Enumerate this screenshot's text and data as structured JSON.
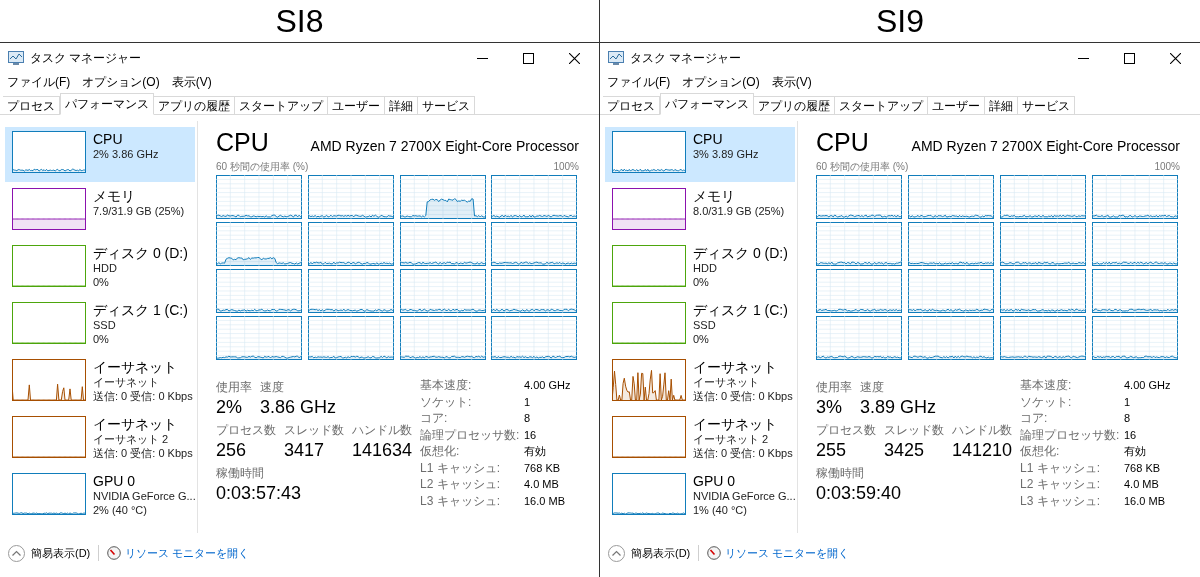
{
  "panels": [
    {
      "heading": "SI8",
      "window": {
        "title": "タスク マネージャー"
      },
      "menu": [
        "ファイル(F)",
        "オプション(O)",
        "表示(V)"
      ],
      "tabs": [
        {
          "label": "プロセス",
          "selected": false
        },
        {
          "label": "パフォーマンス",
          "selected": true
        },
        {
          "label": "アプリの履歴",
          "selected": false
        },
        {
          "label": "スタートアップ",
          "selected": false
        },
        {
          "label": "ユーザー",
          "selected": false
        },
        {
          "label": "詳細",
          "selected": false
        },
        {
          "label": "サービス",
          "selected": false
        }
      ],
      "sidebar": {
        "items": [
          {
            "kind": "cpu",
            "title": "CPU",
            "lines": [
              "2%  3.86 GHz"
            ],
            "selected": true
          },
          {
            "kind": "memory",
            "title": "メモリ",
            "lines": [
              "7.9/31.9 GB (25%)"
            ],
            "selected": false
          },
          {
            "kind": "disk",
            "title": "ディスク 0 (D:)",
            "lines": [
              "HDD",
              "0%"
            ],
            "selected": false
          },
          {
            "kind": "disk",
            "title": "ディスク 1 (C:)",
            "lines": [
              "SSD",
              "0%"
            ],
            "selected": false
          },
          {
            "kind": "ethernet",
            "title": "イーサネット",
            "lines": [
              "イーサネット",
              "送信: 0 受信: 0 Kbps"
            ],
            "selected": false
          },
          {
            "kind": "ethernet",
            "title": "イーサネット",
            "lines": [
              "イーサネット 2",
              "送信: 0 受信: 0 Kbps"
            ],
            "selected": false
          },
          {
            "kind": "gpu",
            "title": "GPU 0",
            "lines": [
              "NVIDIA GeForce G...",
              "2% (40 °C)"
            ],
            "selected": false
          }
        ]
      },
      "main": {
        "title": "CPU",
        "processor": "AMD Ryzen 7 2700X Eight-Core Processor",
        "graph_caption": "60 秒間の使用率 (%)",
        "graph_max": "100%",
        "stat_rows": [
          [
            {
              "label": "使用率",
              "value": "2%"
            },
            {
              "label": "速度",
              "value": "3.86 GHz"
            }
          ],
          [
            {
              "label": "プロセス数",
              "value": "256"
            },
            {
              "label": "スレッド数",
              "value": "3417"
            },
            {
              "label": "ハンドル数",
              "value": "141634"
            }
          ],
          [
            {
              "label": "稼働時間",
              "value": "0:03:57:43"
            }
          ]
        ],
        "details": [
          {
            "label": "基本速度:",
            "value": "4.00 GHz"
          },
          {
            "label": "ソケット:",
            "value": "1"
          },
          {
            "label": "コア:",
            "value": "8"
          },
          {
            "label": "論理プロセッサ数:",
            "value": "16"
          },
          {
            "label": "仮想化:",
            "value": "有効"
          },
          {
            "label": "L1 キャッシュ:",
            "value": "768 KB"
          },
          {
            "label": "L2 キャッシュ:",
            "value": "4.0 MB"
          },
          {
            "label": "L3 キャッシュ:",
            "value": "16.0 MB"
          }
        ]
      },
      "footer": {
        "collapse": "簡易表示(D)",
        "link": "リソース モニターを開く"
      }
    },
    {
      "heading": "SI9",
      "window": {
        "title": "タスク マネージャー"
      },
      "menu": [
        "ファイル(F)",
        "オプション(O)",
        "表示(V)"
      ],
      "tabs": [
        {
          "label": "プロセス",
          "selected": false
        },
        {
          "label": "パフォーマンス",
          "selected": true
        },
        {
          "label": "アプリの履歴",
          "selected": false
        },
        {
          "label": "スタートアップ",
          "selected": false
        },
        {
          "label": "ユーザー",
          "selected": false
        },
        {
          "label": "詳細",
          "selected": false
        },
        {
          "label": "サービス",
          "selected": false
        }
      ],
      "sidebar": {
        "items": [
          {
            "kind": "cpu",
            "title": "CPU",
            "lines": [
              "3%  3.89 GHz"
            ],
            "selected": true
          },
          {
            "kind": "memory",
            "title": "メモリ",
            "lines": [
              "8.0/31.9 GB (25%)"
            ],
            "selected": false
          },
          {
            "kind": "disk",
            "title": "ディスク 0 (D:)",
            "lines": [
              "HDD",
              "0%"
            ],
            "selected": false
          },
          {
            "kind": "disk",
            "title": "ディスク 1 (C:)",
            "lines": [
              "SSD",
              "0%"
            ],
            "selected": false
          },
          {
            "kind": "ethernet",
            "title": "イーサネット",
            "lines": [
              "イーサネット",
              "送信: 0 受信: 0 Kbps"
            ],
            "selected": false
          },
          {
            "kind": "ethernet",
            "title": "イーサネット",
            "lines": [
              "イーサネット 2",
              "送信: 0 受信: 0 Kbps"
            ],
            "selected": false
          },
          {
            "kind": "gpu",
            "title": "GPU 0",
            "lines": [
              "NVIDIA GeForce G...",
              "1% (40 °C)"
            ],
            "selected": false
          }
        ]
      },
      "main": {
        "title": "CPU",
        "processor": "AMD Ryzen 7 2700X Eight-Core Processor",
        "graph_caption": "60 秒間の使用率 (%)",
        "graph_max": "100%",
        "stat_rows": [
          [
            {
              "label": "使用率",
              "value": "3%"
            },
            {
              "label": "速度",
              "value": "3.89 GHz"
            }
          ],
          [
            {
              "label": "プロセス数",
              "value": "255"
            },
            {
              "label": "スレッド数",
              "value": "3425"
            },
            {
              "label": "ハンドル数",
              "value": "141210"
            }
          ],
          [
            {
              "label": "稼働時間",
              "value": "0:03:59:40"
            }
          ]
        ],
        "details": [
          {
            "label": "基本速度:",
            "value": "4.00 GHz"
          },
          {
            "label": "ソケット:",
            "value": "1"
          },
          {
            "label": "コア:",
            "value": "8"
          },
          {
            "label": "論理プロセッサ数:",
            "value": "16"
          },
          {
            "label": "仮想化:",
            "value": "有効"
          },
          {
            "label": "L1 キャッシュ:",
            "value": "768 KB"
          },
          {
            "label": "L2 キャッシュ:",
            "value": "4.0 MB"
          },
          {
            "label": "L3 キャッシュ:",
            "value": "16.0 MB"
          }
        ]
      },
      "footer": {
        "collapse": "簡易表示(D)",
        "link": "リソース モニターを開く"
      }
    }
  ]
}
